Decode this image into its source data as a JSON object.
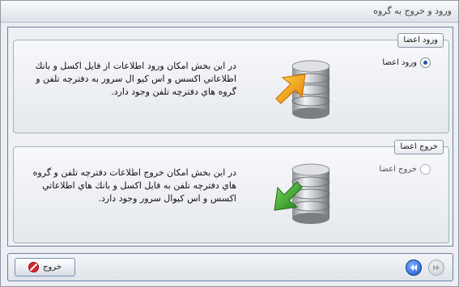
{
  "window": {
    "title": "ورود و خروج به گروه"
  },
  "import_group": {
    "legend": "ورود اعضا",
    "radio_label": "ورود اعضا",
    "selected": true,
    "description": "در اين بخش امكان ورود اطلاعات از فايل اكسل و بانك اطلاعاتي اكسس و اس كيو ال سرور به دفترچه تلفن و گروه هاي دفترچه تلفن وجود دارد.",
    "icon": "database-import-icon"
  },
  "export_group": {
    "legend": "خروج اعضا",
    "radio_label": "خروج اعضا",
    "selected": false,
    "description": "در اين بخش امكان خروج اطلاعات دفترچه تلفن و گروه هاي دفترچه تلفن به فايل اكسل و بانك هاي اطلاعاتي اكسس و اس كيوال سرور وجود دارد.",
    "icon": "database-export-icon"
  },
  "footer": {
    "exit_label": "خروج",
    "exit_icon": "no-entry-icon",
    "prev_icon": "rewind-icon",
    "next_icon": "fast-forward-icon"
  },
  "colors": {
    "accent_blue": "#1a57c7",
    "import_arrow": "#f5a20a",
    "export_arrow": "#2f9a2a"
  }
}
